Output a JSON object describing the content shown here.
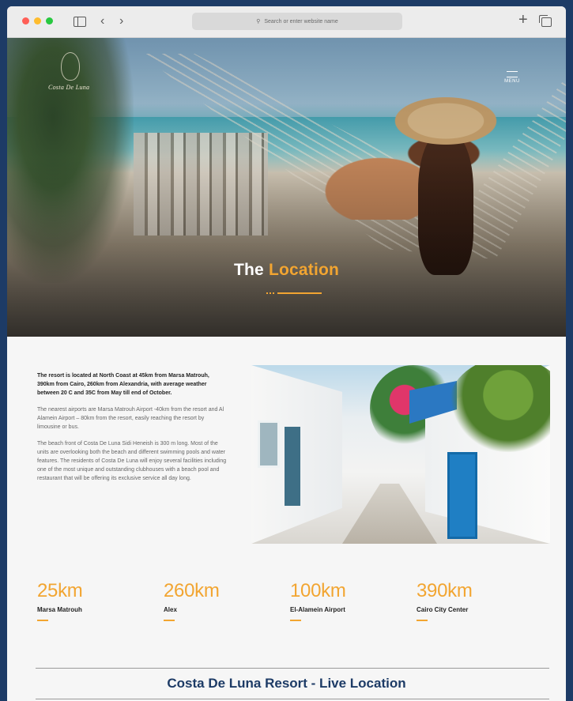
{
  "browser": {
    "address_placeholder": "Search or enter website name"
  },
  "hero": {
    "logo_text": "Costa De Luna",
    "menu_label": "MENU",
    "title_white": "The",
    "title_accent": "Location"
  },
  "about": {
    "lead": "The resort is located at North Coast at 45km from Marsa Matrouh, 390km from Cairo, 260km from Alexandria, with average weather between 20 C and 35C from May till end of October.",
    "airports": "The nearest airports are Marsa Matrouh Airport -40km from the resort and Al Alamein Airport – 80km from the resort, easily reaching the resort by limousine or bus.",
    "beach": "The beach front of Costa De Luna Sidi Heneish is 300 m long. Most of the units are overlooking both the beach and different swimming pools and water features. The residents of Costa De Luna will enjoy several facilities including one of the most unique and outstanding clubhouses with a beach pool and restaurant that will be offering its exclusive service all day long."
  },
  "stats": [
    {
      "value": "25km",
      "label": "Marsa Matrouh"
    },
    {
      "value": "260km",
      "label": "Alex"
    },
    {
      "value": "100km",
      "label": "El-Alamein Airport"
    },
    {
      "value": "390km",
      "label": "Cairo City Center"
    }
  ],
  "live_location": {
    "title": "Costa De Luna Resort - Live Location"
  },
  "colors": {
    "accent": "#f2a531",
    "navy": "#1d3b66"
  },
  "icons": [
    "close-dot-icon",
    "minimize-dot-icon",
    "zoom-dot-icon",
    "sidebar-icon",
    "back-icon",
    "forward-icon",
    "search-icon",
    "new-tab-icon",
    "tabs-overview-icon",
    "menu-icon"
  ]
}
